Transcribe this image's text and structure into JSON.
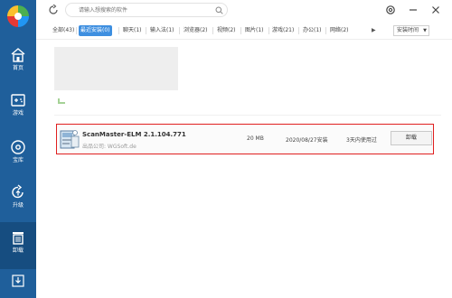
{
  "sidebar": {
    "items": [
      {
        "label": "首页",
        "icon": "home-icon"
      },
      {
        "label": "游戏",
        "icon": "gamepad-icon"
      },
      {
        "label": "宝库",
        "icon": "disc-icon"
      },
      {
        "label": "升级",
        "icon": "upgrade-icon"
      },
      {
        "label": "卸载",
        "icon": "trash-icon"
      }
    ],
    "active_index": 4
  },
  "search": {
    "placeholder": "请输入想搜索的软件"
  },
  "tabs": [
    {
      "label": "全部(43)"
    },
    {
      "label": "最近安装(0)"
    },
    {
      "label": "聊天(1)"
    },
    {
      "label": "输入法(1)"
    },
    {
      "label": "浏览器(2)"
    },
    {
      "label": "视频(2)"
    },
    {
      "label": "图片(1)"
    },
    {
      "label": "游戏(21)"
    },
    {
      "label": "办公(1)"
    },
    {
      "label": "网络(2)"
    }
  ],
  "active_tab_index": 1,
  "tabs_more_arrow": "▶",
  "sort": {
    "selected": "安装时间"
  },
  "app_row": {
    "name": "ScanMaster-ELM 2.1.104.771",
    "publisher": "出品公司: WGSoft.de",
    "size": "20 MB",
    "install_date": "2020/08/27安装",
    "usage": "3天内使用过",
    "uninstall_label": "卸载"
  },
  "colors": {
    "sidebar": "#1f5f9b",
    "sidebar_active": "#164d80",
    "accent": "#3e8fe0",
    "highlight_border": "#e02020"
  }
}
